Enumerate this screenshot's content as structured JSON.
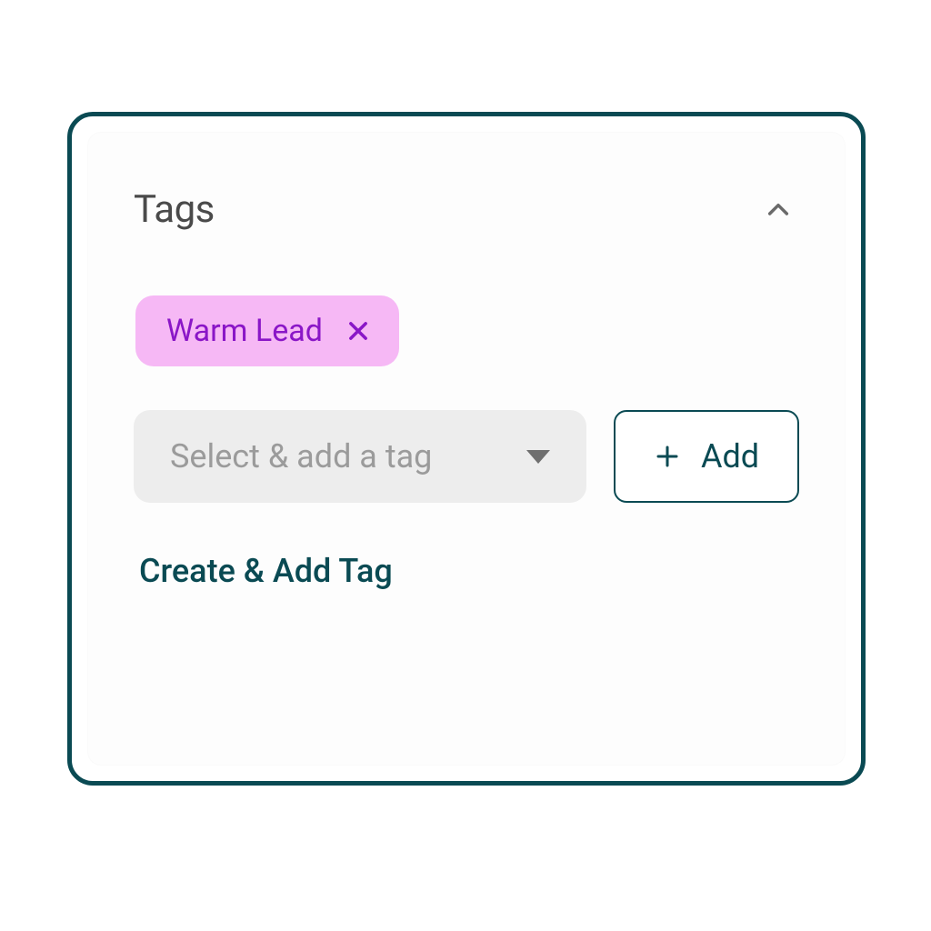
{
  "section": {
    "title": "Tags"
  },
  "tags": [
    {
      "label": "Warm Lead",
      "bg": "#f6b8f5",
      "fg": "#8a16c7"
    }
  ],
  "select": {
    "placeholder": "Select & add a tag"
  },
  "add_button": {
    "label": "Add"
  },
  "create_link": {
    "label": "Create & Add Tag"
  },
  "icons": {
    "collapse": "chevron-up-icon",
    "remove": "close-icon",
    "dropdown": "caret-down-icon",
    "add": "plus-icon"
  },
  "colors": {
    "panel_border": "#0a4a53",
    "accent": "#0a4a53",
    "select_bg": "#ededed",
    "placeholder": "#9b9b9b"
  }
}
